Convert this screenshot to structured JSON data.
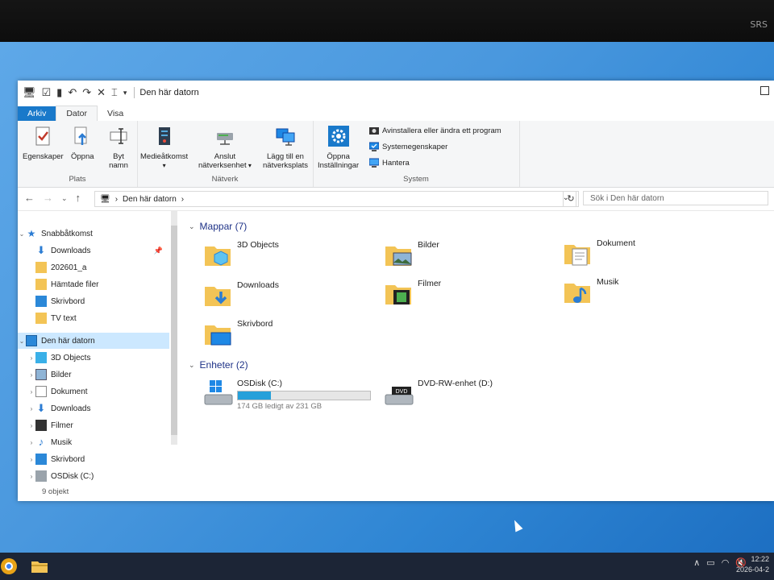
{
  "bezel": {
    "brand": "SRS"
  },
  "window": {
    "title": "Den här datorn"
  },
  "tabs": {
    "arkiv": "Arkiv",
    "dator": "Dator",
    "visa": "Visa"
  },
  "ribbon": {
    "plats": {
      "label": "Plats",
      "egenskaper": "Egenskaper",
      "oppna": "Öppna",
      "byt": "Byt",
      "namn": "namn"
    },
    "natverk": {
      "label": "Nätverk",
      "media1": "Medieåtkomst",
      "anslut1": "Anslut",
      "anslut2": "nätverksenhet",
      "lagg1": "Lägg till en",
      "lagg2": "nätverksplats"
    },
    "system": {
      "label": "System",
      "oppna1": "Öppna",
      "oppna2": "Inställningar",
      "avinstallera": "Avinstallera eller ändra ett program",
      "systemegenskaper": "Systemegenskaper",
      "hantera": "Hantera"
    }
  },
  "address": {
    "location": "Den här datorn",
    "search_placeholder": "Sök i Den här datorn"
  },
  "nav": {
    "quick_access": "Snabbåtkomst",
    "quick_items": [
      "Downloads",
      "202601_a",
      "Hämtade filer",
      "Skrivbord",
      "TV text"
    ],
    "this_pc": "Den här datorn",
    "pc_items": [
      "3D Objects",
      "Bilder",
      "Dokument",
      "Downloads",
      "Filmer",
      "Musik",
      "Skrivbord",
      "OSDisk (C:)"
    ]
  },
  "status": {
    "text": "9 objekt"
  },
  "folders": {
    "header": "Mappar (7)",
    "items": [
      "3D Objects",
      "Bilder",
      "Dokument",
      "Downloads",
      "Filmer",
      "Musik",
      "Skrivbord"
    ]
  },
  "devices": {
    "header": "Enheter (2)",
    "c_name": "OSDisk (C:)",
    "c_free": "174 GB ledigt av 231 GB",
    "c_used_fraction": 0.247,
    "d_name": "DVD-RW-enhet (D:)",
    "dvd_label": "DVD"
  },
  "taskbar": {
    "time": "12:22",
    "date": "2026-04-2"
  },
  "colors": {
    "accent": "#1979ca",
    "folder": "#f3c456",
    "selection": "#cce8ff",
    "drive_bar": "#26a0da"
  }
}
